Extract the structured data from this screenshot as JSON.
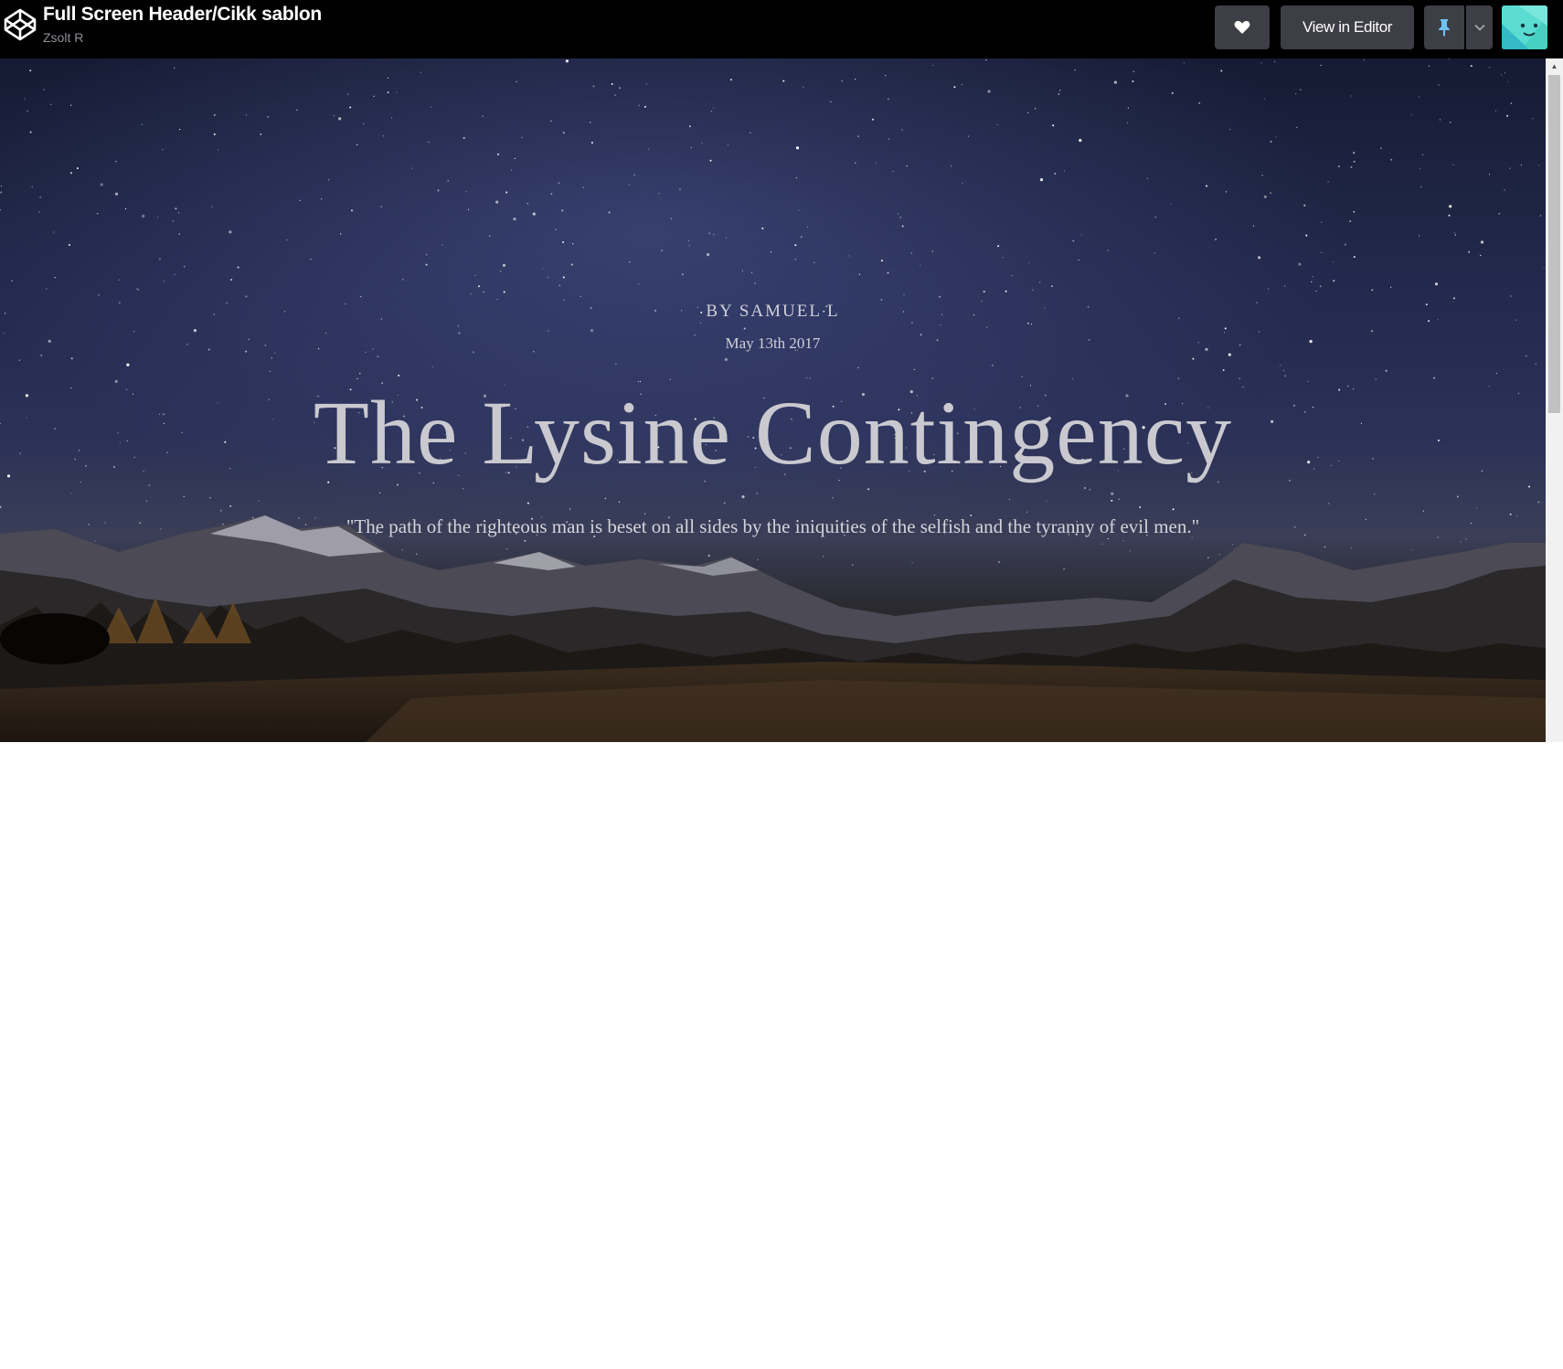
{
  "header": {
    "title": "Full Screen Header/Cikk sablon",
    "author": "Zsolt R",
    "logo_icon": "codepen-cube-icon",
    "heart_icon": "heart-icon",
    "editor_label": "View in Editor",
    "pin_icon": "pin-icon",
    "caret_icon": "chevron-down-icon",
    "avatar_icon": "smiley-avatar"
  },
  "article": {
    "byline": "BY SAMUEL L",
    "date": "May 13th 2017",
    "headline": "The Lysine Contingency",
    "quote": "\"The path of the righteous man is beset on all sides by the iniquities of the selfish and the tyranny of evil men.\""
  },
  "colors": {
    "topbar_bg": "#000000",
    "button_bg": "#3d3e46",
    "pin_accent": "#6ec3f4",
    "avatar_accent": "#47d1c3"
  }
}
